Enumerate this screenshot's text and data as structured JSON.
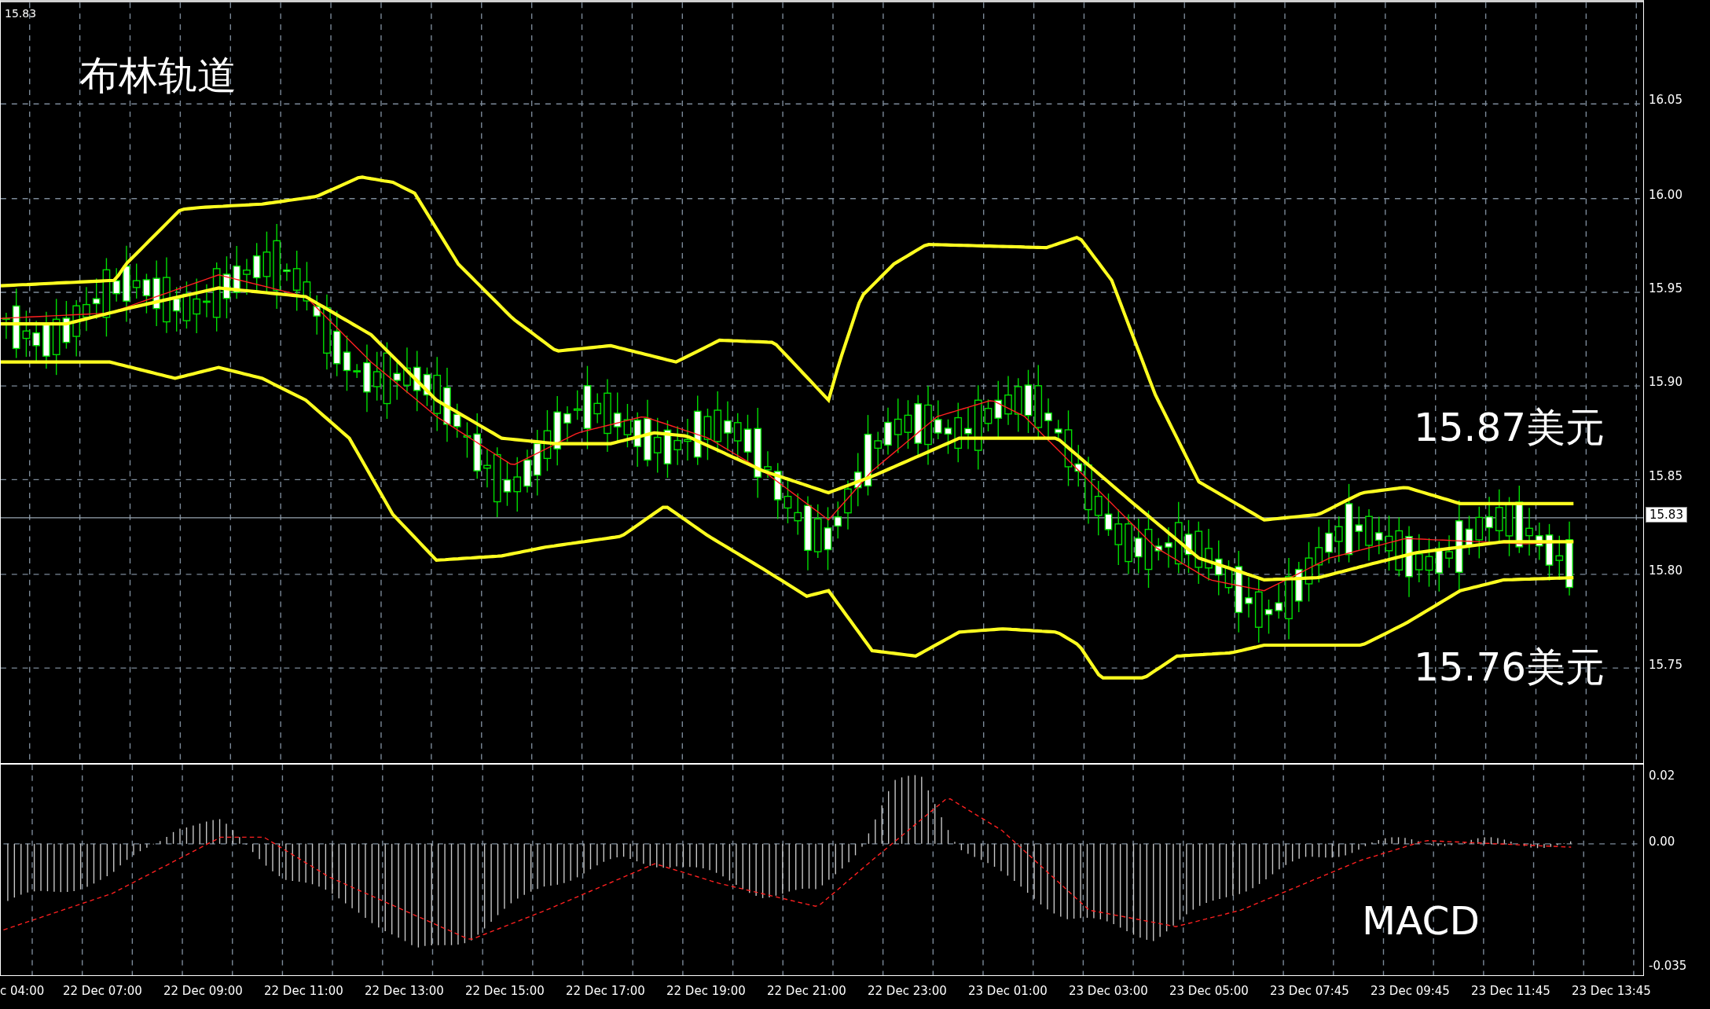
{
  "chart": {
    "title": "布林轨道",
    "corner_price": "15.83",
    "annotations": [
      "15.87美元",
      "15.76美元"
    ]
  },
  "price_axis": {
    "labels": [
      "16.05",
      "16.00",
      "15.95",
      "15.90",
      "15.85",
      "15.80",
      "15.75"
    ],
    "current": "15.83"
  },
  "macd": {
    "label": "MACD",
    "axis_labels": [
      "0.02",
      "0.00",
      "-0.035"
    ]
  },
  "time_axis": {
    "labels": [
      "c 04:00",
      "22 Dec 07:00",
      "22 Dec 09:00",
      "22 Dec 11:00",
      "22 Dec 13:00",
      "22 Dec 15:00",
      "22 Dec 17:00",
      "22 Dec 19:00",
      "22 Dec 21:00",
      "22 Dec 23:00",
      "23 Dec 01:00",
      "23 Dec 03:00",
      "23 Dec 05:00",
      "23 Dec 07:45",
      "23 Dec 09:45",
      "23 Dec 11:45",
      "23 Dec 13:45"
    ]
  }
}
